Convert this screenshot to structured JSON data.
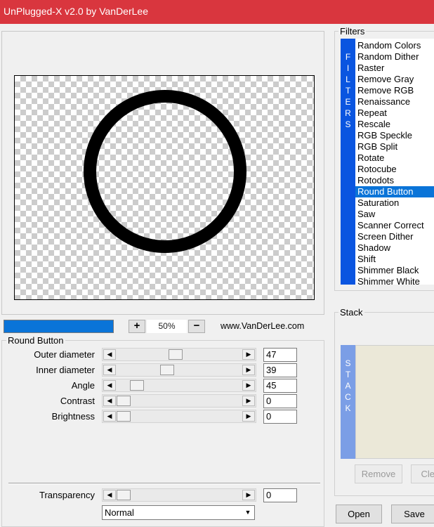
{
  "window": {
    "title": "UnPlugged-X v2.0 by VanDerLee"
  },
  "zoom": {
    "minus": "+",
    "value": "50%",
    "plus": "−",
    "progress": 1.0
  },
  "website": "www.VanDerLee.com",
  "parameters": {
    "group_title": "Round Button",
    "rows": [
      {
        "label": "Outer diameter",
        "value": "47",
        "fraction": 0.47
      },
      {
        "label": "Inner diameter",
        "value": "39",
        "fraction": 0.39
      },
      {
        "label": "Angle",
        "value": "45",
        "fraction": 0.12
      },
      {
        "label": "Contrast",
        "value": "0",
        "fraction": 0.0
      },
      {
        "label": "Brightness",
        "value": "0",
        "fraction": 0.0
      }
    ],
    "transparency": {
      "label": "Transparency",
      "value": "0",
      "fraction": 0.0
    },
    "blend_mode": "Normal"
  },
  "filters": {
    "title": "Filters",
    "vertical_label": [
      "F",
      "I",
      "L",
      "T",
      "E",
      "R",
      "S"
    ],
    "items": [
      "Random Colors",
      "Random Dither",
      "Raster",
      "Remove Gray",
      "Remove RGB",
      "Renaissance",
      "Repeat",
      "Rescale",
      "RGB Speckle",
      "RGB Split",
      "Rotate",
      "Rotocube",
      "Rotodots",
      "Round Button",
      "Saturation",
      "Saw",
      "Scanner Correct",
      "Screen Dither",
      "Shadow",
      "Shift",
      "Shimmer Black",
      "Shimmer White"
    ],
    "selected": "Round Button"
  },
  "stack": {
    "title": "Stack",
    "vertical_label": [
      "S",
      "T",
      "A",
      "C",
      "K"
    ],
    "remove": "Remove",
    "clear": "Clear"
  },
  "buttons": {
    "open": "Open",
    "save": "Save"
  },
  "colors": {
    "titlebar": "#d9363e",
    "accent": "#0a74d8",
    "filter_sidebar": "#0a55e0",
    "stack_sidebar": "#7b9ee6"
  }
}
